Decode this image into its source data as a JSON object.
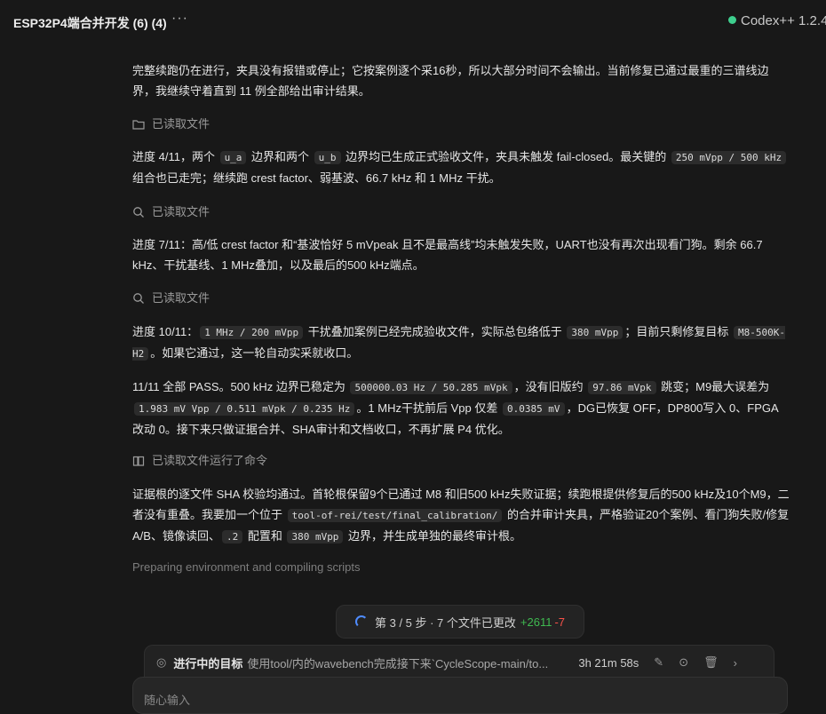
{
  "header": {
    "title": "ESP32P4端合并开发 (6) (4)",
    "more": "···",
    "brand": "Codex++ 1.2.4"
  },
  "messages": {
    "p1": {
      "t1": "完整续跑仍在进行，夹具没有报错或停止；它按案例逐个采16秒，所以大部分时间不会输出。当前修复已通过最重的三谱线边界，我继续守着直到 11 例全部给出审计结果。"
    },
    "tool1": "已读取文件",
    "p2": {
      "t1": "进度 4/11，两个 ",
      "c1": "u_a",
      "t2": " 边界和两个 ",
      "c2": "u_b",
      "t3": " 边界均已生成正式验收文件，夹具未触发 fail-closed。最关键的 ",
      "c3": "250 mVpp / 500 kHz",
      "t4": " 组合也已走完；继续跑 crest factor、弱基波、66.7 kHz 和 1 MHz 干扰。"
    },
    "tool2": "已读取文件",
    "p3": {
      "t1": "进度 7/11：高/低 crest factor 和“基波恰好 5 mVpeak 且不是最高线”均未触发失败，UART也没有再次出现看门狗。剩余 66.7 kHz、干扰基线、1 MHz叠加，以及最后的500 kHz端点。"
    },
    "tool3": "已读取文件",
    "p4": {
      "t1": "进度 10/11：",
      "c1": "1 MHz / 200 mVpp",
      "t2": " 干扰叠加案例已经完成验收文件，实际总包络低于 ",
      "c2": "380 mVpp",
      "t3": "；目前只剩修复目标 ",
      "c3": "M8-500K-H2",
      "t4": "。如果它通过，这一轮自动实采就收口。"
    },
    "p5": {
      "t1": "11/11 全部 PASS。500 kHz 边界已稳定为 ",
      "c1": "500000.03 Hz / 50.285 mVpk",
      "t2": "，没有旧版约 ",
      "c2": "97.86 mVpk",
      "t3": " 跳变；M9最大误差为 ",
      "c3": "1.983 mV Vpp / 0.511 mVpk / 0.235 Hz",
      "t4": "。1 MHz干扰前后 Vpp 仅差 ",
      "c4": "0.0385 mV",
      "t5": "，DG已恢复 OFF，DP800写入 0、FPGA改动 0。接下来只做证据合并、SHA审计和文档收口，不再扩展 P4 优化。"
    },
    "tool4": "已读取文件运行了命令",
    "p6": {
      "t1": "证据根的逐文件 SHA 校验均通过。首轮根保留9个已通过 M8 和旧500 kHz失败证据；续跑根提供修复后的500 kHz及10个M9，二者没有重叠。我要加一个位于 ",
      "c1": "tool-of-rei/test/final_calibration/",
      "t2": " 的合并审计夹具，严格验证20个案例、看门狗失败/修复 A/B、镜像读回、",
      "c2": ".2",
      "t3": " 配置和 ",
      "c3": "380 mVpp",
      "t4": " 边界，并生成单独的最终审计根。"
    },
    "status": "Preparing environment and compiling scripts"
  },
  "steps": {
    "text": "第 3 / 5 步 · 7 个文件已更改",
    "plus": "+2611",
    "minus": "-7"
  },
  "goal": {
    "label": "进行中的目标",
    "desc": "使用tool/内的wavebench完成接下来`CycleScope-main/to...",
    "time": "3h 21m 58s",
    "icons": [
      "edit-icon",
      "stop-icon",
      "trash-icon",
      "chevron-right-icon"
    ]
  },
  "input": {
    "placeholder": "随心输入"
  },
  "colors": {
    "accent": "#4f8cff",
    "added": "#3fb950",
    "removed": "#f85149",
    "status": "#3ecf8e"
  }
}
